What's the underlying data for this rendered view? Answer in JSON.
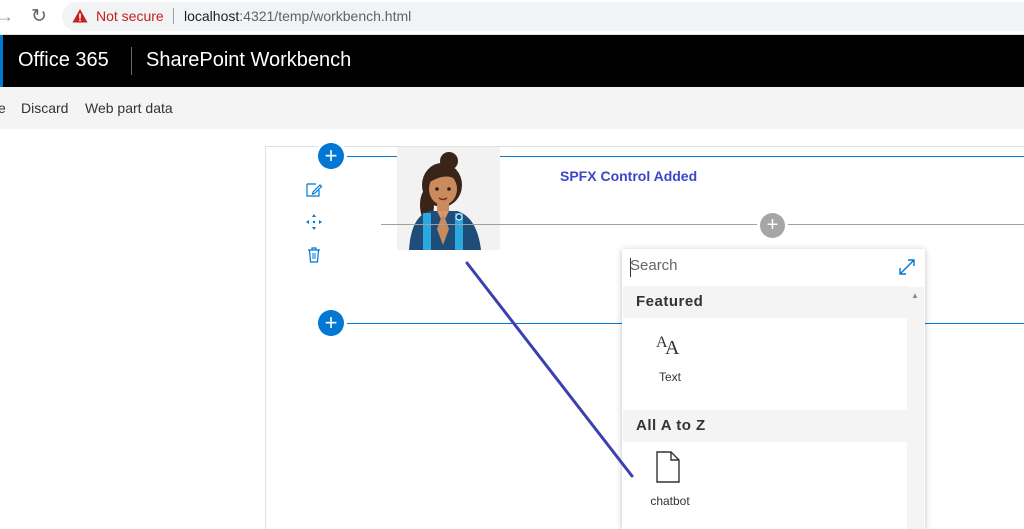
{
  "browser": {
    "security_label": "Not secure",
    "url_host": "localhost",
    "url_rest": ":4321/temp/workbench.html"
  },
  "suitebar": {
    "brand": "Office 365",
    "app_title": "SharePoint Workbench"
  },
  "commands": {
    "partial": "e",
    "discard": "Discard",
    "web_part_data": "Web part data"
  },
  "canvas": {
    "webpart_title": "SPFX Control Added"
  },
  "toolbox": {
    "search_placeholder": "Search",
    "featured_heading": "Featured",
    "featured_items": [
      {
        "label": "Text",
        "icon": "text-icon"
      }
    ],
    "all_heading": "All A to Z",
    "all_items": [
      {
        "label": "chatbot",
        "icon": "document-icon"
      }
    ]
  },
  "colors": {
    "accent": "#0078d4",
    "webpart_title": "#3b46c8",
    "annotation_line": "#3b3fb0",
    "not_secure": "#c5221f"
  }
}
